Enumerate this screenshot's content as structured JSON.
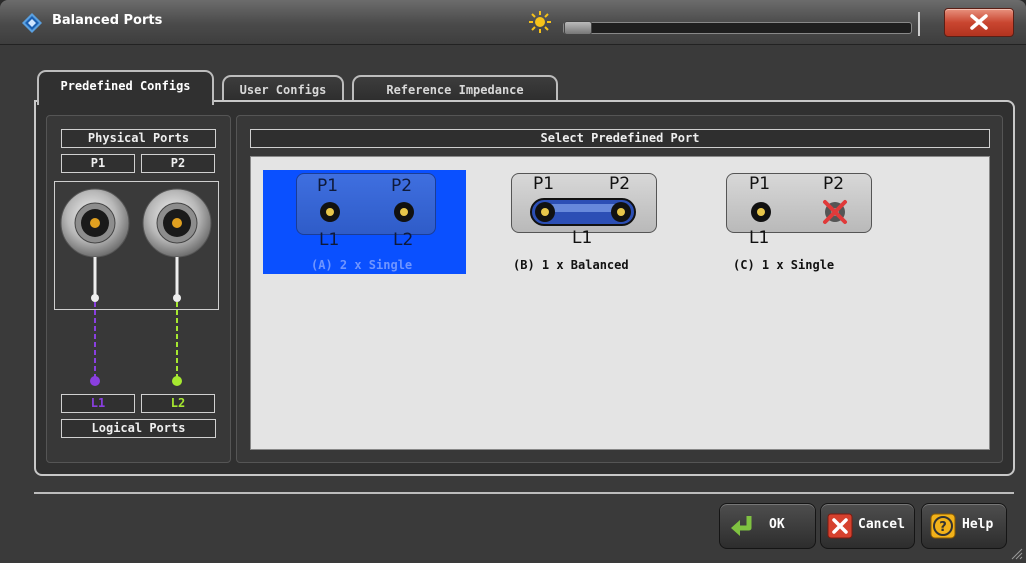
{
  "window": {
    "title": "Balanced Ports"
  },
  "tabs": [
    {
      "label": "Predefined Configs",
      "active": true
    },
    {
      "label": "User Configs",
      "active": false
    },
    {
      "label": "Reference Impedance",
      "active": false
    }
  ],
  "left_panel": {
    "physical_header": "Physical Ports",
    "physical_ports": [
      "P1",
      "P2"
    ],
    "logical_ports": [
      "L1",
      "L2"
    ],
    "logical_header": "Logical Ports",
    "l1_color": "#8a3fe0",
    "l2_color": "#a6e830"
  },
  "right_panel": {
    "header": "Select Predefined Port",
    "options": [
      {
        "p1": "P1",
        "p2": "P2",
        "l1": "L1",
        "l2": "L2",
        "caption": "(A) 2 x Single",
        "selected": true
      },
      {
        "p1": "P1",
        "p2": "P2",
        "l1": "L1",
        "caption": "(B) 1 x Balanced",
        "selected": false
      },
      {
        "p1": "P1",
        "p2": "P2",
        "l1": "L1",
        "caption": "(C) 1 x Single",
        "selected": false
      }
    ]
  },
  "buttons": {
    "ok": "OK",
    "cancel": "Cancel",
    "help": "Help"
  },
  "colors": {
    "selection": "#0a50ff",
    "close": "#c94630"
  }
}
